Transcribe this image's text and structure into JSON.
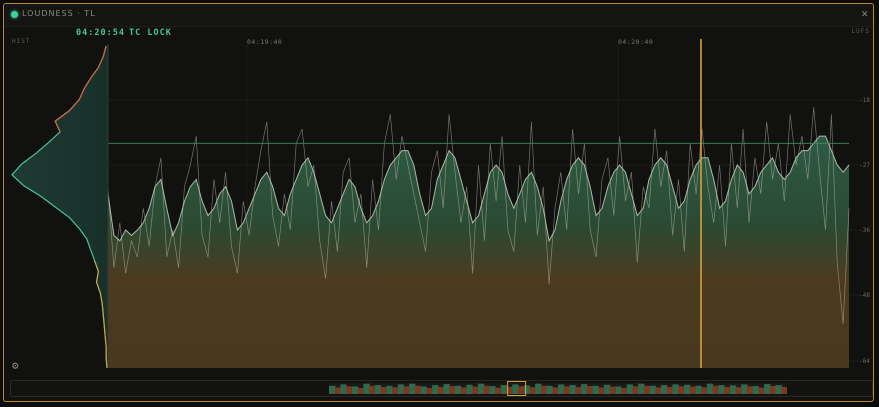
{
  "window": {
    "title": "LOUDNESS · TL"
  },
  "panel": {
    "hist_label": "HIST",
    "timecode": "04:20:54",
    "tc_status": "TC LOCK",
    "unit_label": "LUFS",
    "time_ticks": [
      "04:19:40",
      "04:20:40"
    ]
  },
  "colors": {
    "accent": "#d9a03a",
    "green": "#4cc296",
    "frame": "#b98a2e",
    "hist_top": "#d2633e"
  },
  "chart_data": {
    "type": "area",
    "title": "",
    "xlabel": "",
    "ylabel": "LUFS",
    "y_ticks": [
      "-18",
      "-27",
      "-36",
      "-48",
      "-64"
    ],
    "target_line": -24,
    "playhead_time": "04:20:54",
    "series": [
      {
        "name": "",
        "kind": "short-term (filled)",
        "values": [
          -31,
          -37,
          -38,
          -36,
          -37,
          -36,
          -35,
          -33,
          -30,
          -29,
          -33,
          -37,
          -35,
          -32,
          -30,
          -29,
          -32,
          -34,
          -33,
          -31,
          -30,
          -32,
          -36,
          -35,
          -33,
          -31,
          -29,
          -28,
          -30,
          -33,
          -34,
          -31,
          -29,
          -27,
          -26,
          -28,
          -31,
          -34,
          -35,
          -33,
          -31,
          -29,
          -30,
          -33,
          -35,
          -34,
          -32,
          -29,
          -27,
          -26,
          -25,
          -25,
          -27,
          -31,
          -34,
          -33,
          -29,
          -27,
          -25,
          -26,
          -29,
          -32,
          -35,
          -34,
          -31,
          -28,
          -27,
          -28,
          -31,
          -33,
          -31,
          -29,
          -28,
          -30,
          -33,
          -38,
          -36,
          -32,
          -29,
          -27,
          -26,
          -27,
          -30,
          -34,
          -33,
          -30,
          -28,
          -27,
          -28,
          -31,
          -34,
          -33,
          -29,
          -27,
          -26,
          -27,
          -30,
          -33,
          -32,
          -29,
          -27,
          -26,
          -26,
          -29,
          -33,
          -32,
          -29,
          -27,
          -28,
          -31,
          -30,
          -28,
          -27,
          -26,
          -28,
          -29,
          -28,
          -26,
          -25,
          -25,
          -24,
          -23,
          -23,
          -25,
          -27,
          -28,
          -27
        ]
      },
      {
        "name": "",
        "kind": "momentary (line)",
        "values": [
          -30,
          -43,
          -35,
          -44,
          -38,
          -41,
          -33,
          -39,
          -30,
          -26,
          -41,
          -36,
          -43,
          -30,
          -27,
          -23,
          -37,
          -41,
          -29,
          -35,
          -28,
          -39,
          -44,
          -32,
          -37,
          -30,
          -25,
          -21,
          -34,
          -39,
          -31,
          -36,
          -24,
          -22,
          -30,
          -27,
          -38,
          -45,
          -32,
          -40,
          -28,
          -26,
          -35,
          -31,
          -43,
          -29,
          -36,
          -24,
          -20,
          -29,
          -23,
          -27,
          -31,
          -35,
          -40,
          -28,
          -25,
          -33,
          -20,
          -28,
          -35,
          -30,
          -44,
          -27,
          -38,
          -24,
          -32,
          -23,
          -36,
          -40,
          -27,
          -35,
          -21,
          -37,
          -30,
          -46,
          -33,
          -28,
          -36,
          -22,
          -31,
          -24,
          -36,
          -41,
          -29,
          -26,
          -34,
          -23,
          -32,
          -28,
          -42,
          -30,
          -33,
          -22,
          -30,
          -25,
          -37,
          -29,
          -40,
          -24,
          -31,
          -22,
          -30,
          -35,
          -27,
          -39,
          -24,
          -33,
          -22,
          -35,
          -26,
          -31,
          -21,
          -29,
          -24,
          -32,
          -20,
          -27,
          -23,
          -29,
          -19,
          -28,
          -36,
          -20,
          -42,
          -55,
          -33
        ]
      }
    ],
    "histogram": {
      "orientation": "vertical",
      "values": [
        0.02,
        0.05,
        0.1,
        0.18,
        0.25,
        0.3,
        0.4,
        0.55,
        0.5,
        0.62,
        0.75,
        0.9,
        1.0,
        0.88,
        0.7,
        0.55,
        0.4,
        0.3,
        0.22,
        0.18,
        0.14,
        0.1,
        0.12,
        0.08,
        0.06,
        0.05,
        0.04,
        0.03,
        0.02,
        0.02,
        0.01
      ]
    },
    "overview": {
      "values": [
        0.6,
        0.8,
        0.5,
        0.9,
        0.7,
        0.6,
        0.8,
        0.9,
        0.5,
        0.7,
        0.85,
        0.6,
        0.75,
        0.9,
        0.55,
        0.7,
        0.8,
        0.65,
        0.9,
        0.6,
        0.8,
        0.7,
        0.85,
        0.6,
        0.75,
        0.5,
        0.8,
        0.9,
        0.6,
        0.7,
        0.8,
        0.75,
        0.6,
        0.9,
        0.7,
        0.65,
        0.8,
        0.55,
        0.85,
        0.7
      ],
      "window_position": 0.39
    }
  }
}
